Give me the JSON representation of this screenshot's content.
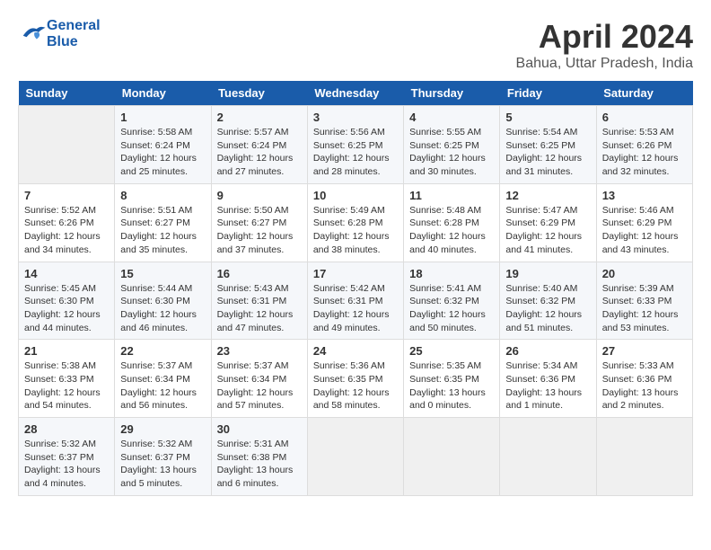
{
  "header": {
    "logo_line1": "General",
    "logo_line2": "Blue",
    "month": "April 2024",
    "location": "Bahua, Uttar Pradesh, India"
  },
  "weekdays": [
    "Sunday",
    "Monday",
    "Tuesday",
    "Wednesday",
    "Thursday",
    "Friday",
    "Saturday"
  ],
  "weeks": [
    [
      {
        "day": "",
        "info": ""
      },
      {
        "day": "1",
        "info": "Sunrise: 5:58 AM\nSunset: 6:24 PM\nDaylight: 12 hours\nand 25 minutes."
      },
      {
        "day": "2",
        "info": "Sunrise: 5:57 AM\nSunset: 6:24 PM\nDaylight: 12 hours\nand 27 minutes."
      },
      {
        "day": "3",
        "info": "Sunrise: 5:56 AM\nSunset: 6:25 PM\nDaylight: 12 hours\nand 28 minutes."
      },
      {
        "day": "4",
        "info": "Sunrise: 5:55 AM\nSunset: 6:25 PM\nDaylight: 12 hours\nand 30 minutes."
      },
      {
        "day": "5",
        "info": "Sunrise: 5:54 AM\nSunset: 6:25 PM\nDaylight: 12 hours\nand 31 minutes."
      },
      {
        "day": "6",
        "info": "Sunrise: 5:53 AM\nSunset: 6:26 PM\nDaylight: 12 hours\nand 32 minutes."
      }
    ],
    [
      {
        "day": "7",
        "info": "Sunrise: 5:52 AM\nSunset: 6:26 PM\nDaylight: 12 hours\nand 34 minutes."
      },
      {
        "day": "8",
        "info": "Sunrise: 5:51 AM\nSunset: 6:27 PM\nDaylight: 12 hours\nand 35 minutes."
      },
      {
        "day": "9",
        "info": "Sunrise: 5:50 AM\nSunset: 6:27 PM\nDaylight: 12 hours\nand 37 minutes."
      },
      {
        "day": "10",
        "info": "Sunrise: 5:49 AM\nSunset: 6:28 PM\nDaylight: 12 hours\nand 38 minutes."
      },
      {
        "day": "11",
        "info": "Sunrise: 5:48 AM\nSunset: 6:28 PM\nDaylight: 12 hours\nand 40 minutes."
      },
      {
        "day": "12",
        "info": "Sunrise: 5:47 AM\nSunset: 6:29 PM\nDaylight: 12 hours\nand 41 minutes."
      },
      {
        "day": "13",
        "info": "Sunrise: 5:46 AM\nSunset: 6:29 PM\nDaylight: 12 hours\nand 43 minutes."
      }
    ],
    [
      {
        "day": "14",
        "info": "Sunrise: 5:45 AM\nSunset: 6:30 PM\nDaylight: 12 hours\nand 44 minutes."
      },
      {
        "day": "15",
        "info": "Sunrise: 5:44 AM\nSunset: 6:30 PM\nDaylight: 12 hours\nand 46 minutes."
      },
      {
        "day": "16",
        "info": "Sunrise: 5:43 AM\nSunset: 6:31 PM\nDaylight: 12 hours\nand 47 minutes."
      },
      {
        "day": "17",
        "info": "Sunrise: 5:42 AM\nSunset: 6:31 PM\nDaylight: 12 hours\nand 49 minutes."
      },
      {
        "day": "18",
        "info": "Sunrise: 5:41 AM\nSunset: 6:32 PM\nDaylight: 12 hours\nand 50 minutes."
      },
      {
        "day": "19",
        "info": "Sunrise: 5:40 AM\nSunset: 6:32 PM\nDaylight: 12 hours\nand 51 minutes."
      },
      {
        "day": "20",
        "info": "Sunrise: 5:39 AM\nSunset: 6:33 PM\nDaylight: 12 hours\nand 53 minutes."
      }
    ],
    [
      {
        "day": "21",
        "info": "Sunrise: 5:38 AM\nSunset: 6:33 PM\nDaylight: 12 hours\nand 54 minutes."
      },
      {
        "day": "22",
        "info": "Sunrise: 5:37 AM\nSunset: 6:34 PM\nDaylight: 12 hours\nand 56 minutes."
      },
      {
        "day": "23",
        "info": "Sunrise: 5:37 AM\nSunset: 6:34 PM\nDaylight: 12 hours\nand 57 minutes."
      },
      {
        "day": "24",
        "info": "Sunrise: 5:36 AM\nSunset: 6:35 PM\nDaylight: 12 hours\nand 58 minutes."
      },
      {
        "day": "25",
        "info": "Sunrise: 5:35 AM\nSunset: 6:35 PM\nDaylight: 13 hours\nand 0 minutes."
      },
      {
        "day": "26",
        "info": "Sunrise: 5:34 AM\nSunset: 6:36 PM\nDaylight: 13 hours\nand 1 minute."
      },
      {
        "day": "27",
        "info": "Sunrise: 5:33 AM\nSunset: 6:36 PM\nDaylight: 13 hours\nand 2 minutes."
      }
    ],
    [
      {
        "day": "28",
        "info": "Sunrise: 5:32 AM\nSunset: 6:37 PM\nDaylight: 13 hours\nand 4 minutes."
      },
      {
        "day": "29",
        "info": "Sunrise: 5:32 AM\nSunset: 6:37 PM\nDaylight: 13 hours\nand 5 minutes."
      },
      {
        "day": "30",
        "info": "Sunrise: 5:31 AM\nSunset: 6:38 PM\nDaylight: 13 hours\nand 6 minutes."
      },
      {
        "day": "",
        "info": ""
      },
      {
        "day": "",
        "info": ""
      },
      {
        "day": "",
        "info": ""
      },
      {
        "day": "",
        "info": ""
      }
    ]
  ]
}
